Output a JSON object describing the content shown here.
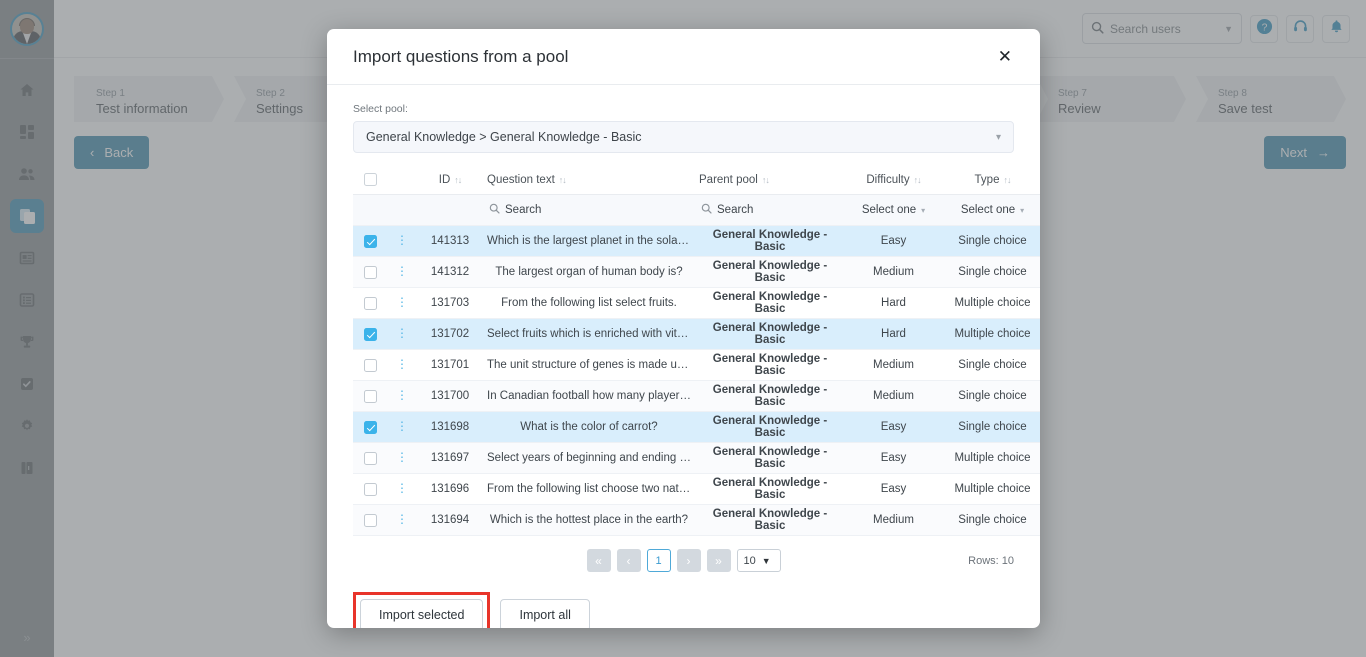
{
  "app": {
    "topbar": {
      "search_placeholder": "Search users",
      "icons": [
        "help-icon",
        "support-headset-icon",
        "notifications-bell-icon"
      ]
    },
    "sidebar": {
      "items": [
        {
          "name": "home-icon"
        },
        {
          "name": "dashboard-icon"
        },
        {
          "name": "users-icon"
        },
        {
          "name": "tests-icon"
        },
        {
          "name": "news-icon"
        },
        {
          "name": "list-icon"
        },
        {
          "name": "trophy-icon"
        },
        {
          "name": "assignments-icon"
        },
        {
          "name": "settings-gear-icon"
        },
        {
          "name": "library-icon"
        }
      ],
      "collapse_label": "»"
    },
    "wizard": {
      "steps": [
        {
          "num": "Step 1",
          "label": "Test information"
        },
        {
          "num": "Step 2",
          "label": "Settings"
        },
        {
          "num": "Step 7",
          "label": "Review"
        },
        {
          "num": "Step 8",
          "label": "Save test"
        }
      ],
      "back_label": "Back",
      "next_label": "Next"
    }
  },
  "modal": {
    "title": "Import questions from a pool",
    "close_label": "✕",
    "pool_field_label": "Select pool:",
    "pool_value": "General Knowledge > General Knowledge - Basic",
    "table": {
      "columns": [
        {
          "label": "ID",
          "sortable": true
        },
        {
          "label": "Question text",
          "sortable": true
        },
        {
          "label": "Parent pool",
          "sortable": true
        },
        {
          "label": "Difficulty",
          "sortable": true
        },
        {
          "label": "Type",
          "sortable": true
        }
      ],
      "filters": {
        "question_text": "Search",
        "parent_pool": "Search",
        "difficulty": "Select one",
        "type": "Select one"
      },
      "rows": [
        {
          "selected": true,
          "id": "141313",
          "question": "Which is the largest planet in the solar sys…",
          "pool": "General Knowledge - Basic",
          "difficulty": "Easy",
          "type": "Single choice"
        },
        {
          "selected": false,
          "id": "141312",
          "question": "The largest organ of human body is?",
          "pool": "General Knowledge - Basic",
          "difficulty": "Medium",
          "type": "Single choice"
        },
        {
          "selected": false,
          "id": "131703",
          "question": "From the following list select fruits.",
          "pool": "General Knowledge - Basic",
          "difficulty": "Hard",
          "type": "Multiple choice"
        },
        {
          "selected": true,
          "id": "131702",
          "question": "Select fruits which is enriched with vitami…",
          "pool": "General Knowledge - Basic",
          "difficulty": "Hard",
          "type": "Multiple choice"
        },
        {
          "selected": false,
          "id": "131701",
          "question": "The unit structure of genes is made up of ?",
          "pool": "General Knowledge - Basic",
          "difficulty": "Medium",
          "type": "Single choice"
        },
        {
          "selected": false,
          "id": "131700",
          "question": "In Canadian football how many players are…",
          "pool": "General Knowledge - Basic",
          "difficulty": "Medium",
          "type": "Single choice"
        },
        {
          "selected": true,
          "id": "131698",
          "question": "What is the color of carrot?",
          "pool": "General Knowledge - Basic",
          "difficulty": "Easy",
          "type": "Single choice"
        },
        {
          "selected": false,
          "id": "131697",
          "question": "Select years of beginning and ending of W…",
          "pool": "General Knowledge - Basic",
          "difficulty": "Easy",
          "type": "Multiple choice"
        },
        {
          "selected": false,
          "id": "131696",
          "question": "From the following list choose two natural …",
          "pool": "General Knowledge - Basic",
          "difficulty": "Easy",
          "type": "Multiple choice"
        },
        {
          "selected": false,
          "id": "131694",
          "question": "Which is the hottest place in the earth?",
          "pool": "General Knowledge - Basic",
          "difficulty": "Medium",
          "type": "Single choice"
        }
      ]
    },
    "pagination": {
      "first_label": "«",
      "prev_label": "‹",
      "current_page": "1",
      "next_label": "›",
      "last_label": "»",
      "page_size": "10",
      "rows_label": "Rows: 10"
    },
    "footer": {
      "import_selected_label": "Import selected",
      "import_all_label": "Import all"
    }
  },
  "colors": {
    "accent_blue": "#2a7fa3",
    "link_blue": "#2bace2",
    "checkbox_on": "#3bb3ea",
    "row_selected": "#d9eefc",
    "highlight_red": "#e8342a"
  }
}
